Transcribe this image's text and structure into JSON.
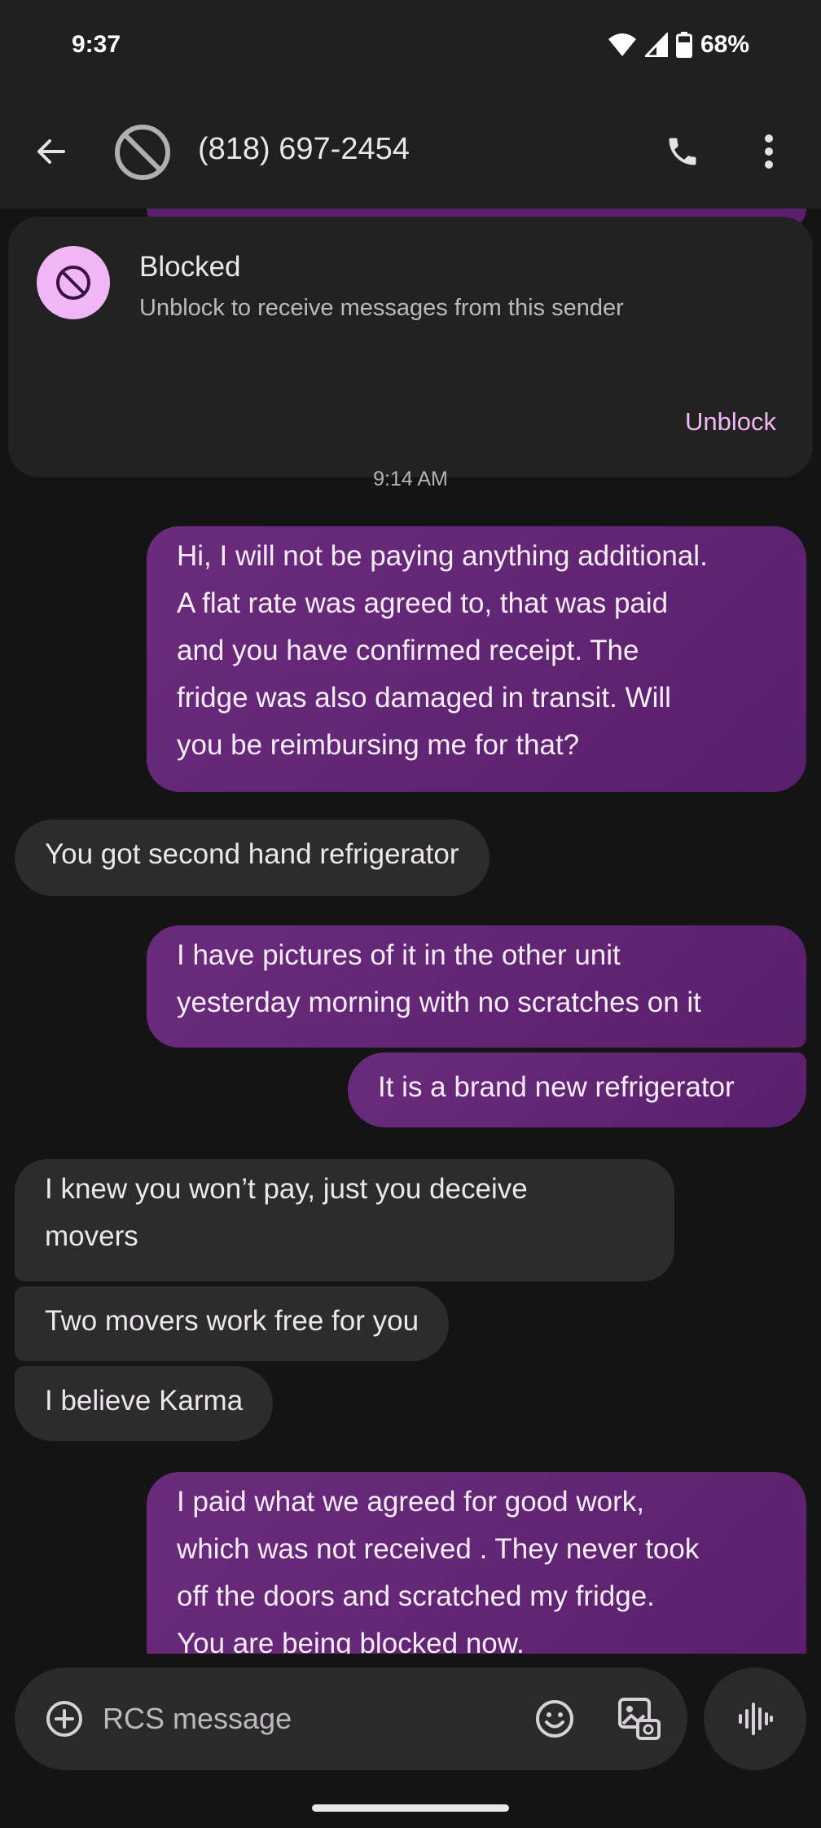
{
  "status_bar": {
    "time": "9:37",
    "battery": "68%",
    "icons": [
      "wifi-icon",
      "cell-signal-icon",
      "battery-icon"
    ]
  },
  "header": {
    "title": "(818) 697-2454",
    "icons": [
      "back-arrow-icon",
      "blocked-icon",
      "phone-icon",
      "more-vert-icon"
    ]
  },
  "blocked_banner": {
    "title": "Blocked",
    "subtitle": "Unblock to receive messages from this sender",
    "action": "Unblock",
    "icon": "blocked-icon"
  },
  "timestamp": "9:14 AM",
  "messages": [
    {
      "direction": "outgoing",
      "lines": [
        "Hi, I will not be paying anything additional.",
        "A flat rate was agreed to, that was paid",
        "and you have confirmed receipt. The",
        "fridge was also damaged in transit. Will",
        "you be reimbursing me for that?"
      ]
    },
    {
      "direction": "incoming",
      "lines": [
        "You got second hand refrigerator"
      ]
    },
    {
      "direction": "outgoing",
      "lines": [
        "I have pictures of it in the other unit",
        "yesterday morning with no scratches on it"
      ]
    },
    {
      "direction": "outgoing",
      "lines": [
        "It is a brand new refrigerator"
      ]
    },
    {
      "direction": "incoming",
      "lines": [
        "I knew you won’t pay, just you deceive",
        "movers"
      ]
    },
    {
      "direction": "incoming",
      "lines": [
        "Two movers work free for you"
      ]
    },
    {
      "direction": "incoming",
      "lines": [
        "I believe Karma"
      ]
    },
    {
      "direction": "outgoing",
      "lines": [
        "I paid what we agreed for good work,",
        "which was not received . They never took",
        "off the doors and scratched my fridge.",
        "You are being blocked now."
      ]
    }
  ],
  "composer": {
    "placeholder": "RCS message",
    "icons": [
      "add-icon",
      "emoji-icon",
      "gallery-icon",
      "voice-icon"
    ]
  },
  "colors": {
    "outgoing_bubble": "#6b2b7d",
    "incoming_bubble": "#2c2c2c",
    "accent": "#f2b8f5",
    "background": "#141414",
    "bar": "#202020"
  }
}
